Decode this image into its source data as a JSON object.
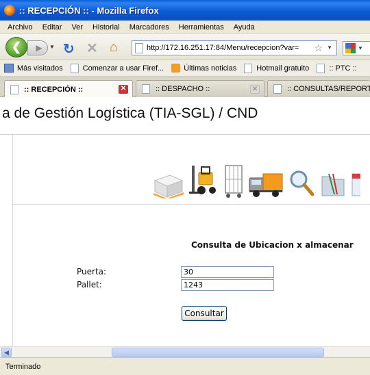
{
  "window": {
    "title": ":: RECEPCIÓN :: - Mozilla Firefox"
  },
  "menu": [
    "Archivo",
    "Editar",
    "Ver",
    "Historial",
    "Marcadores",
    "Herramientas",
    "Ayuda"
  ],
  "nav": {
    "url": "http://172.16.251.17:84/Menu/recepcion?var="
  },
  "bookmarks": [
    "Más visitados",
    "Comenzar a usar Firef...",
    "Últimas noticias",
    "Hotmail gratuito",
    ":: PTC ::"
  ],
  "tabs": [
    {
      "label": ":: RECEPCIÓN ::",
      "active": true
    },
    {
      "label": ":: DESPACHO ::",
      "active": false
    },
    {
      "label": ":: CONSULTAS/REPORTES",
      "active": false
    }
  ],
  "page": {
    "system_title": "a de Gestión Logística (TIA-SGL) / CND",
    "icons": [
      "pallet-icon",
      "forklift-icon",
      "cage-cart-icon",
      "truck-icon",
      "magnifier-icon",
      "folder-icon",
      "calendar-icon"
    ],
    "form": {
      "title": "Consulta de Ubicacion x almacenar",
      "puerta_label": "Puerta:",
      "puerta_value": "30",
      "pallet_label": "Pallet:",
      "pallet_value": "1243",
      "submit_label": "Consultar"
    }
  },
  "status": {
    "text": "Terminado"
  }
}
